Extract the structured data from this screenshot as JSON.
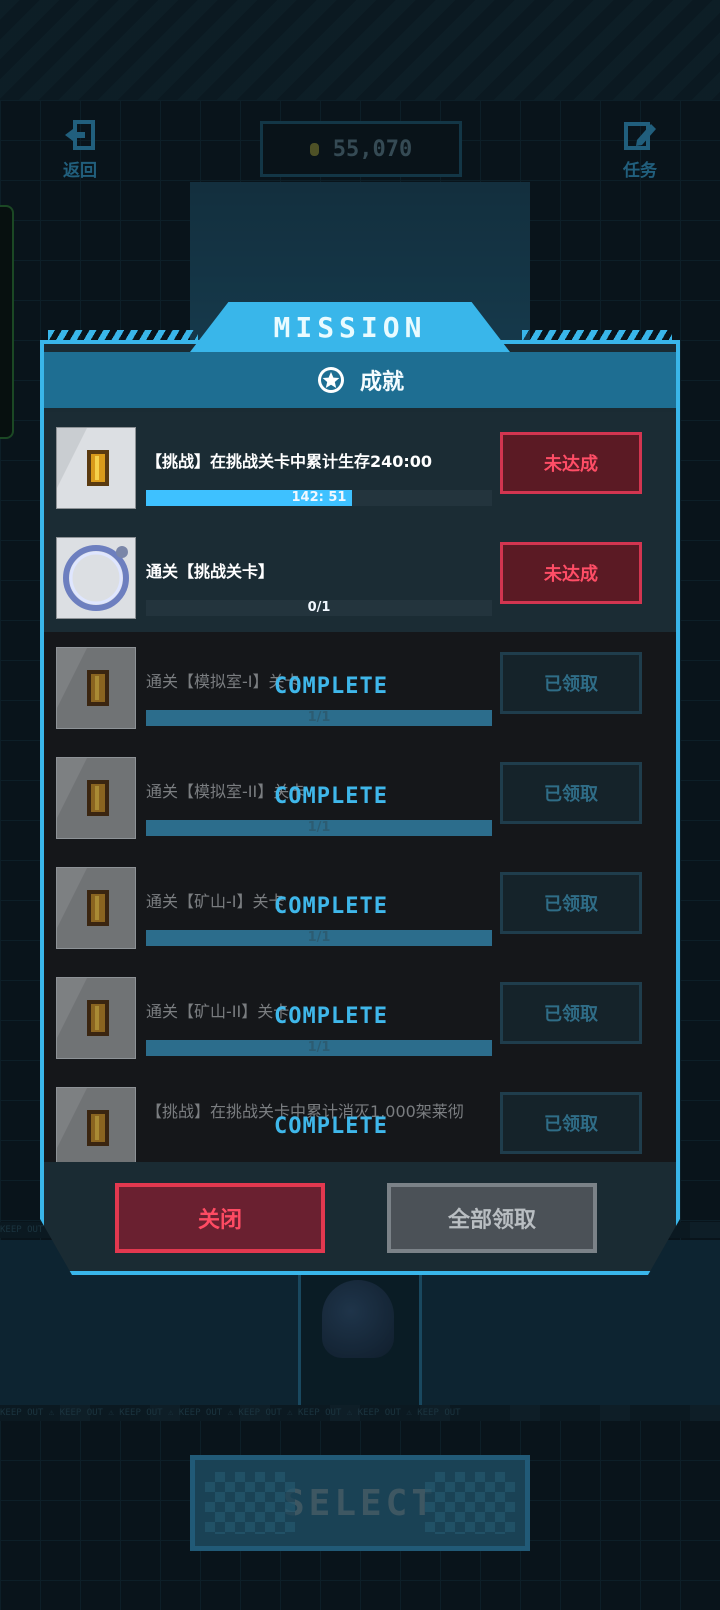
{
  "topbar": {
    "back_label": "返回",
    "coins": "55,070",
    "missions_label": "任务"
  },
  "background": {
    "hazard_text": "KEEP OUT  ⚠  KEEP OUT  ⚠  KEEP OUT  ⚠  KEEP OUT  ⚠  KEEP OUT  ⚠  KEEP OUT  ⚠  KEEP OUT  ⚠  KEEP OUT",
    "select_label": "SELECT"
  },
  "modal": {
    "tab_title": "MISSION",
    "section_title": "成就",
    "rows": [
      {
        "title": "【挑战】在挑战关卡中累计生存240:00",
        "progress_text": "142: 51",
        "progress": 0.595,
        "status": "未达成",
        "state": "active",
        "icon": "coin-icon"
      },
      {
        "title": "通关【挑战关卡】",
        "progress_text": "0/1",
        "progress": 0,
        "status": "未达成",
        "state": "active",
        "icon": "portal-icon"
      },
      {
        "title": "通关【模拟室-I】关卡",
        "progress_text": "1/1",
        "progress": 1,
        "status": "已领取",
        "state": "done",
        "complete": "COMPLETE",
        "icon": "coin-icon"
      },
      {
        "title": "通关【模拟室-II】关卡",
        "progress_text": "1/1",
        "progress": 1,
        "status": "已领取",
        "state": "done",
        "complete": "COMPLETE",
        "icon": "coin-icon"
      },
      {
        "title": "通关【矿山-I】关卡",
        "progress_text": "1/1",
        "progress": 1,
        "status": "已领取",
        "state": "done",
        "complete": "COMPLETE",
        "icon": "coin-icon"
      },
      {
        "title": "通关【矿山-II】关卡",
        "progress_text": "1/1",
        "progress": 1,
        "status": "已领取",
        "state": "done",
        "complete": "COMPLETE",
        "icon": "coin-icon"
      },
      {
        "title": "【挑战】在挑战关卡中累计消灭1,000架莱彻",
        "progress_text": "",
        "progress": 1,
        "status": "已领取",
        "state": "done",
        "complete": "COMPLETE",
        "icon": "coin-icon"
      }
    ],
    "close_label": "关闭",
    "claim_all_label": "全部领取"
  }
}
